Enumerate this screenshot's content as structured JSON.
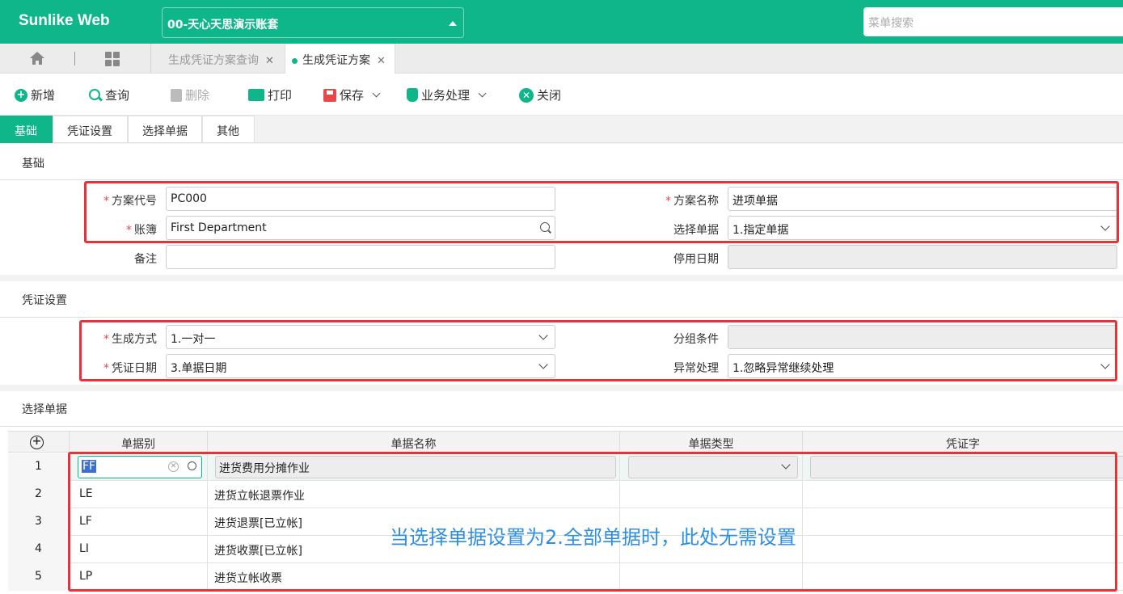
{
  "app": {
    "brand": "Sunlike Web",
    "account": "00-天心天思演示账套",
    "menu_search_placeholder": "菜单搜索"
  },
  "page_tabs": [
    {
      "label": "生成凭证方案查询",
      "active": false
    },
    {
      "label": "生成凭证方案",
      "active": true
    }
  ],
  "toolbar": {
    "add": "新增",
    "query": "查询",
    "delete": "删除",
    "print": "打印",
    "save": "保存",
    "business": "业务处理",
    "close": "关闭"
  },
  "sub_tabs": [
    "基础",
    "凭证设置",
    "选择单据",
    "其他"
  ],
  "basic": {
    "title": "基础",
    "plan_code_label": "方案代号",
    "plan_code": "PC000",
    "plan_name_label": "方案名称",
    "plan_name": "进项单据",
    "book_label": "账簿",
    "book": "First Department",
    "select_doc_label": "选择单据",
    "select_doc": "1.指定单据",
    "remark_label": "备注",
    "remark": "",
    "stop_date_label": "停用日期",
    "stop_date": ""
  },
  "voucher": {
    "title": "凭证设置",
    "gen_mode_label": "生成方式",
    "gen_mode": "1.一对一",
    "group_cond_label": "分组条件",
    "group_cond": "",
    "voucher_date_label": "凭证日期",
    "voucher_date": "3.单据日期",
    "exception_label": "异常处理",
    "exception": "1.忽略异常继续处理"
  },
  "docs": {
    "title": "选择单据",
    "columns": [
      "单据别",
      "单据名称",
      "单据类型",
      "凭证字"
    ],
    "rows": [
      {
        "no": "1",
        "code": "FF",
        "name": "进货费用分摊作业"
      },
      {
        "no": "2",
        "code": "LE",
        "name": "进货立帐退票作业"
      },
      {
        "no": "3",
        "code": "LF",
        "name": "进货退票[已立帐]"
      },
      {
        "no": "4",
        "code": "LI",
        "name": "进货收票[已立帐]"
      },
      {
        "no": "5",
        "code": "LP",
        "name": "进货立帐收票"
      }
    ]
  },
  "annotation": "当选择单据设置为2.全部单据时，此处无需设置",
  "colors": {
    "accent": "#0eb68a",
    "required": "#e8474c",
    "highlight_box": "#e8323a",
    "note": "#2d8ee6"
  }
}
